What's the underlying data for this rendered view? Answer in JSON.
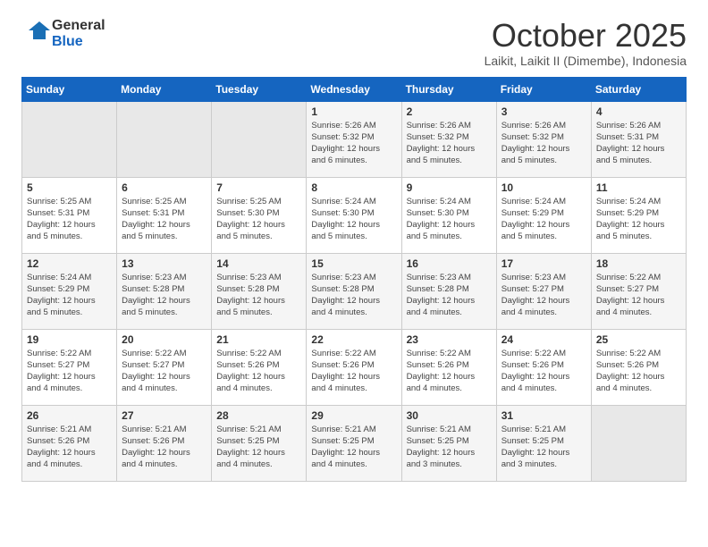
{
  "logo": {
    "line1": "General",
    "line2": "Blue"
  },
  "title": "October 2025",
  "location": "Laikit, Laikit II (Dimembe), Indonesia",
  "days_of_week": [
    "Sunday",
    "Monday",
    "Tuesday",
    "Wednesday",
    "Thursday",
    "Friday",
    "Saturday"
  ],
  "weeks": [
    [
      {
        "day": "",
        "info": ""
      },
      {
        "day": "",
        "info": ""
      },
      {
        "day": "",
        "info": ""
      },
      {
        "day": "1",
        "info": "Sunrise: 5:26 AM\nSunset: 5:32 PM\nDaylight: 12 hours\nand 6 minutes."
      },
      {
        "day": "2",
        "info": "Sunrise: 5:26 AM\nSunset: 5:32 PM\nDaylight: 12 hours\nand 5 minutes."
      },
      {
        "day": "3",
        "info": "Sunrise: 5:26 AM\nSunset: 5:32 PM\nDaylight: 12 hours\nand 5 minutes."
      },
      {
        "day": "4",
        "info": "Sunrise: 5:26 AM\nSunset: 5:31 PM\nDaylight: 12 hours\nand 5 minutes."
      }
    ],
    [
      {
        "day": "5",
        "info": "Sunrise: 5:25 AM\nSunset: 5:31 PM\nDaylight: 12 hours\nand 5 minutes."
      },
      {
        "day": "6",
        "info": "Sunrise: 5:25 AM\nSunset: 5:31 PM\nDaylight: 12 hours\nand 5 minutes."
      },
      {
        "day": "7",
        "info": "Sunrise: 5:25 AM\nSunset: 5:30 PM\nDaylight: 12 hours\nand 5 minutes."
      },
      {
        "day": "8",
        "info": "Sunrise: 5:24 AM\nSunset: 5:30 PM\nDaylight: 12 hours\nand 5 minutes."
      },
      {
        "day": "9",
        "info": "Sunrise: 5:24 AM\nSunset: 5:30 PM\nDaylight: 12 hours\nand 5 minutes."
      },
      {
        "day": "10",
        "info": "Sunrise: 5:24 AM\nSunset: 5:29 PM\nDaylight: 12 hours\nand 5 minutes."
      },
      {
        "day": "11",
        "info": "Sunrise: 5:24 AM\nSunset: 5:29 PM\nDaylight: 12 hours\nand 5 minutes."
      }
    ],
    [
      {
        "day": "12",
        "info": "Sunrise: 5:24 AM\nSunset: 5:29 PM\nDaylight: 12 hours\nand 5 minutes."
      },
      {
        "day": "13",
        "info": "Sunrise: 5:23 AM\nSunset: 5:28 PM\nDaylight: 12 hours\nand 5 minutes."
      },
      {
        "day": "14",
        "info": "Sunrise: 5:23 AM\nSunset: 5:28 PM\nDaylight: 12 hours\nand 5 minutes."
      },
      {
        "day": "15",
        "info": "Sunrise: 5:23 AM\nSunset: 5:28 PM\nDaylight: 12 hours\nand 4 minutes."
      },
      {
        "day": "16",
        "info": "Sunrise: 5:23 AM\nSunset: 5:28 PM\nDaylight: 12 hours\nand 4 minutes."
      },
      {
        "day": "17",
        "info": "Sunrise: 5:23 AM\nSunset: 5:27 PM\nDaylight: 12 hours\nand 4 minutes."
      },
      {
        "day": "18",
        "info": "Sunrise: 5:22 AM\nSunset: 5:27 PM\nDaylight: 12 hours\nand 4 minutes."
      }
    ],
    [
      {
        "day": "19",
        "info": "Sunrise: 5:22 AM\nSunset: 5:27 PM\nDaylight: 12 hours\nand 4 minutes."
      },
      {
        "day": "20",
        "info": "Sunrise: 5:22 AM\nSunset: 5:27 PM\nDaylight: 12 hours\nand 4 minutes."
      },
      {
        "day": "21",
        "info": "Sunrise: 5:22 AM\nSunset: 5:26 PM\nDaylight: 12 hours\nand 4 minutes."
      },
      {
        "day": "22",
        "info": "Sunrise: 5:22 AM\nSunset: 5:26 PM\nDaylight: 12 hours\nand 4 minutes."
      },
      {
        "day": "23",
        "info": "Sunrise: 5:22 AM\nSunset: 5:26 PM\nDaylight: 12 hours\nand 4 minutes."
      },
      {
        "day": "24",
        "info": "Sunrise: 5:22 AM\nSunset: 5:26 PM\nDaylight: 12 hours\nand 4 minutes."
      },
      {
        "day": "25",
        "info": "Sunrise: 5:22 AM\nSunset: 5:26 PM\nDaylight: 12 hours\nand 4 minutes."
      }
    ],
    [
      {
        "day": "26",
        "info": "Sunrise: 5:21 AM\nSunset: 5:26 PM\nDaylight: 12 hours\nand 4 minutes."
      },
      {
        "day": "27",
        "info": "Sunrise: 5:21 AM\nSunset: 5:26 PM\nDaylight: 12 hours\nand 4 minutes."
      },
      {
        "day": "28",
        "info": "Sunrise: 5:21 AM\nSunset: 5:25 PM\nDaylight: 12 hours\nand 4 minutes."
      },
      {
        "day": "29",
        "info": "Sunrise: 5:21 AM\nSunset: 5:25 PM\nDaylight: 12 hours\nand 4 minutes."
      },
      {
        "day": "30",
        "info": "Sunrise: 5:21 AM\nSunset: 5:25 PM\nDaylight: 12 hours\nand 3 minutes."
      },
      {
        "day": "31",
        "info": "Sunrise: 5:21 AM\nSunset: 5:25 PM\nDaylight: 12 hours\nand 3 minutes."
      },
      {
        "day": "",
        "info": ""
      }
    ]
  ]
}
